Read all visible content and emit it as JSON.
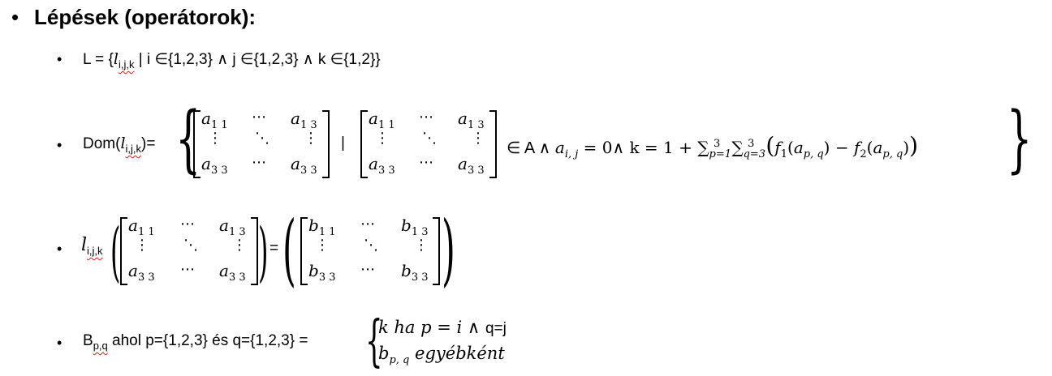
{
  "heading": "Lépések (operátorok):",
  "bullets": {
    "main": "•",
    "sub": "•"
  },
  "line1": {
    "prefix": "L = {",
    "l": "l",
    "l_sub": "i,j,k",
    "middle": " | i ∈{1,2,3} ∧ j ∈{1,2,3} ∧ k ∈{1,2}}"
  },
  "line2": {
    "prefix": "Dom(",
    "l": "l",
    "l_sub": "i,j,k",
    "suffix": ")=",
    "bar": "|",
    "condition_prefix": "∈ A ∧ ",
    "a": "a",
    "a_sub": "i, j",
    "eq": " = 0∧ k = 1 + ∑",
    "sum1_sub": "p=1",
    "sum1_sup": "3",
    "sum2": "∑",
    "sum2_sub": "q=3",
    "sum2_sup": "3",
    "f1": "f",
    "f1_sub": "1",
    "a2": "a",
    "a2_sub": "p, q",
    "minus": " − ",
    "f2": "f",
    "f2_sub": "2",
    "a3": "a",
    "a3_sub": "p, q"
  },
  "line3": {
    "l": "l",
    "l_sub": "i,j,k",
    "eq": "="
  },
  "line4": {
    "prefix": "B",
    "prefix_sub": "p,q",
    "middle": " ahol p={1,2,3} és q={1,2,3} =",
    "case1": "k ha p = i ∧ ",
    "case1_tail": "q=j",
    "case2_b": "b",
    "case2_sub": "p, q",
    "case2_tail": " egyébként"
  },
  "matrix_a": {
    "tl": "a",
    "tl_sub": "1 1",
    "tr": "a",
    "tr_sub": "1 3",
    "bl": "a",
    "bl_sub": "3 3",
    "br": "a",
    "br_sub": "3 3",
    "hdots": "⋯",
    "vdots": "⋮",
    "ddots": "⋱"
  },
  "matrix_b": {
    "tl": "b",
    "tl_sub": "1 1",
    "tr": "b",
    "tr_sub": "1 3",
    "bl": "b",
    "bl_sub": "3 3",
    "br": "b",
    "br_sub": "3 3"
  }
}
